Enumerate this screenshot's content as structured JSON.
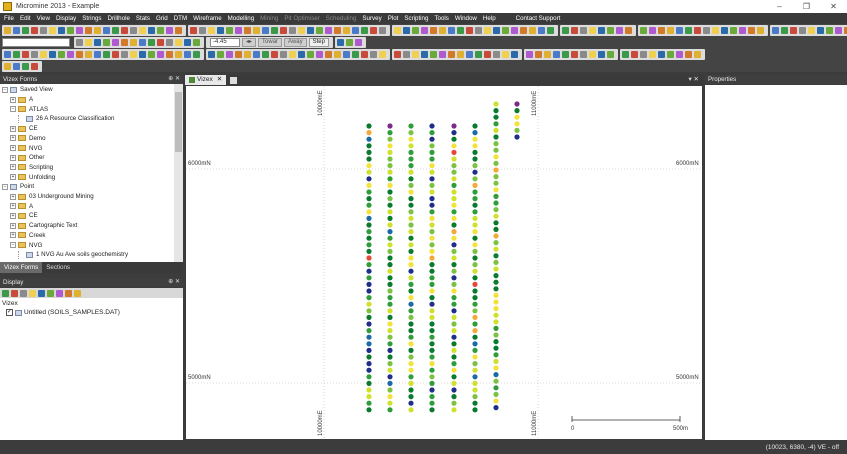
{
  "window": {
    "title": "Micromine 2013 - Example",
    "minimize_glyph": "–",
    "maximize_glyph": "❐",
    "close_glyph": "✕"
  },
  "menu": [
    {
      "label": "File",
      "enabled": true
    },
    {
      "label": "Edit",
      "enabled": true
    },
    {
      "label": "View",
      "enabled": true
    },
    {
      "label": "Display",
      "enabled": true
    },
    {
      "label": "Strings",
      "enabled": true
    },
    {
      "label": "Drillhole",
      "enabled": true
    },
    {
      "label": "Stats",
      "enabled": true
    },
    {
      "label": "Grid",
      "enabled": true
    },
    {
      "label": "DTM",
      "enabled": true
    },
    {
      "label": "Wireframe",
      "enabled": true
    },
    {
      "label": "Modelling",
      "enabled": true
    },
    {
      "label": "Mining",
      "enabled": false
    },
    {
      "label": "Pit Optimiser",
      "enabled": false
    },
    {
      "label": "Scheduling",
      "enabled": false
    },
    {
      "label": "Survey",
      "enabled": true
    },
    {
      "label": "Plot",
      "enabled": true
    },
    {
      "label": "Scripting",
      "enabled": true
    },
    {
      "label": "Tools",
      "enabled": true
    },
    {
      "label": "Window",
      "enabled": true
    },
    {
      "label": "Help",
      "enabled": true
    },
    {
      "label": "Contact Support",
      "enabled": true
    }
  ],
  "toolbar": {
    "rotation_value": "-4.45",
    "toward_label": "Towar",
    "away_label": "Away",
    "step_label": "Step"
  },
  "vizex_forms": {
    "title": "Vizex Forms",
    "pin_glyph": "⊕ ✕",
    "tree": [
      {
        "level": 0,
        "expander": "−",
        "icon": "view",
        "label": "Saved View"
      },
      {
        "level": 1,
        "expander": "+",
        "icon": "folder",
        "label": "A"
      },
      {
        "level": 1,
        "expander": "−",
        "icon": "folder",
        "label": "ATLAS"
      },
      {
        "level": 2,
        "expander": "",
        "icon": "item",
        "label": "26 A Resource Classification"
      },
      {
        "level": 1,
        "expander": "+",
        "icon": "folder",
        "label": "CE"
      },
      {
        "level": 1,
        "expander": "+",
        "icon": "folder",
        "label": "Demo"
      },
      {
        "level": 1,
        "expander": "+",
        "icon": "folder",
        "label": "NVG"
      },
      {
        "level": 1,
        "expander": "+",
        "icon": "folder",
        "label": "Other"
      },
      {
        "level": 1,
        "expander": "+",
        "icon": "folder",
        "label": "Scripting"
      },
      {
        "level": 1,
        "expander": "+",
        "icon": "folder",
        "label": "Unfolding"
      },
      {
        "level": 0,
        "expander": "−",
        "icon": "point",
        "label": "Point"
      },
      {
        "level": 1,
        "expander": "+",
        "icon": "folder",
        "label": "03 Underground Mining"
      },
      {
        "level": 1,
        "expander": "+",
        "icon": "folder",
        "label": "A"
      },
      {
        "level": 1,
        "expander": "+",
        "icon": "folder",
        "label": "CE"
      },
      {
        "level": 1,
        "expander": "+",
        "icon": "folder",
        "label": "Cartographic Text"
      },
      {
        "level": 1,
        "expander": "+",
        "icon": "folder",
        "label": "Creek"
      },
      {
        "level": 1,
        "expander": "−",
        "icon": "folder",
        "label": "NVG"
      },
      {
        "level": 2,
        "expander": "",
        "icon": "item",
        "label": "1 NVG Au Ave soils geochemistry"
      }
    ],
    "tabs": [
      "Vizex Forms",
      "Sections"
    ]
  },
  "display_panel": {
    "title": "Display",
    "root_label": "Vizex",
    "layer_label": "Untitled (SOILS_SAMPLES.DAT)"
  },
  "document": {
    "tab_label": "Vizex",
    "close_glyph": "✕"
  },
  "canvas": {
    "grid_labels": {
      "north_top_left": "6000mN",
      "north_top_right": "6000mN",
      "north_bottom_left": "5000mN",
      "north_bottom_right": "5000mN",
      "east_left_top": "10000mE",
      "east_left_bottom": "10000mE",
      "east_right_top": "11000mE",
      "east_right_bottom": "11000mE"
    },
    "scalebar": {
      "start": "0",
      "end": "500m"
    },
    "palette": [
      "#0a7a2e",
      "#2f9e3a",
      "#7cc242",
      "#cfe12c",
      "#f2e23a",
      "#f3a93a",
      "#e5483a",
      "#1f2e8a",
      "#1a6aa8",
      "#7a2b8a"
    ]
  },
  "properties": {
    "title": "Properties"
  },
  "status": {
    "text": "(10023, 6380, -4)  VE - off"
  }
}
